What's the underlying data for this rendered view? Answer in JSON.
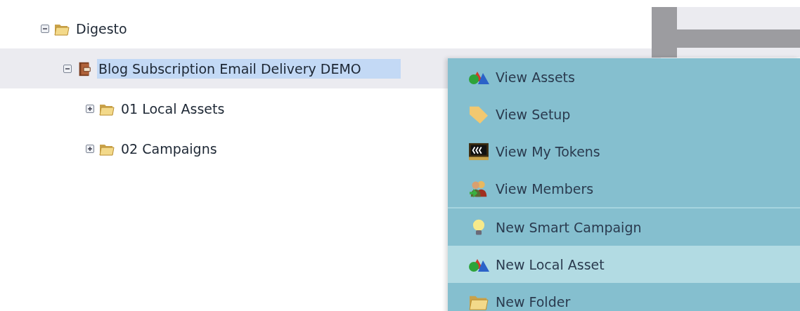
{
  "tree": [
    {
      "label": "Digesto",
      "kind": "folder",
      "expanded": true,
      "selected": false,
      "children": [
        {
          "label": "Blog Subscription Email Delivery DEMO",
          "kind": "program",
          "expanded": true,
          "selected": true,
          "children": [
            {
              "label": "01 Local Assets",
              "kind": "folder",
              "expanded": false,
              "selected": false
            },
            {
              "label": "02 Campaigns",
              "kind": "folder",
              "expanded": false,
              "selected": false
            }
          ]
        }
      ]
    }
  ],
  "context_menu": {
    "groups": [
      [
        {
          "label": "View Assets",
          "kind": "shapes",
          "selected": false
        },
        {
          "label": "View Setup",
          "kind": "tag",
          "selected": false
        },
        {
          "label": "View My Tokens",
          "kind": "tokens",
          "selected": false
        },
        {
          "label": "View Members",
          "kind": "people",
          "selected": false
        }
      ],
      [
        {
          "label": "New Smart Campaign",
          "kind": "bulb",
          "selected": false
        },
        {
          "label": "New Local Asset",
          "kind": "shapes",
          "selected": true
        },
        {
          "label": "New Folder",
          "kind": "folder",
          "selected": false
        }
      ]
    ]
  }
}
